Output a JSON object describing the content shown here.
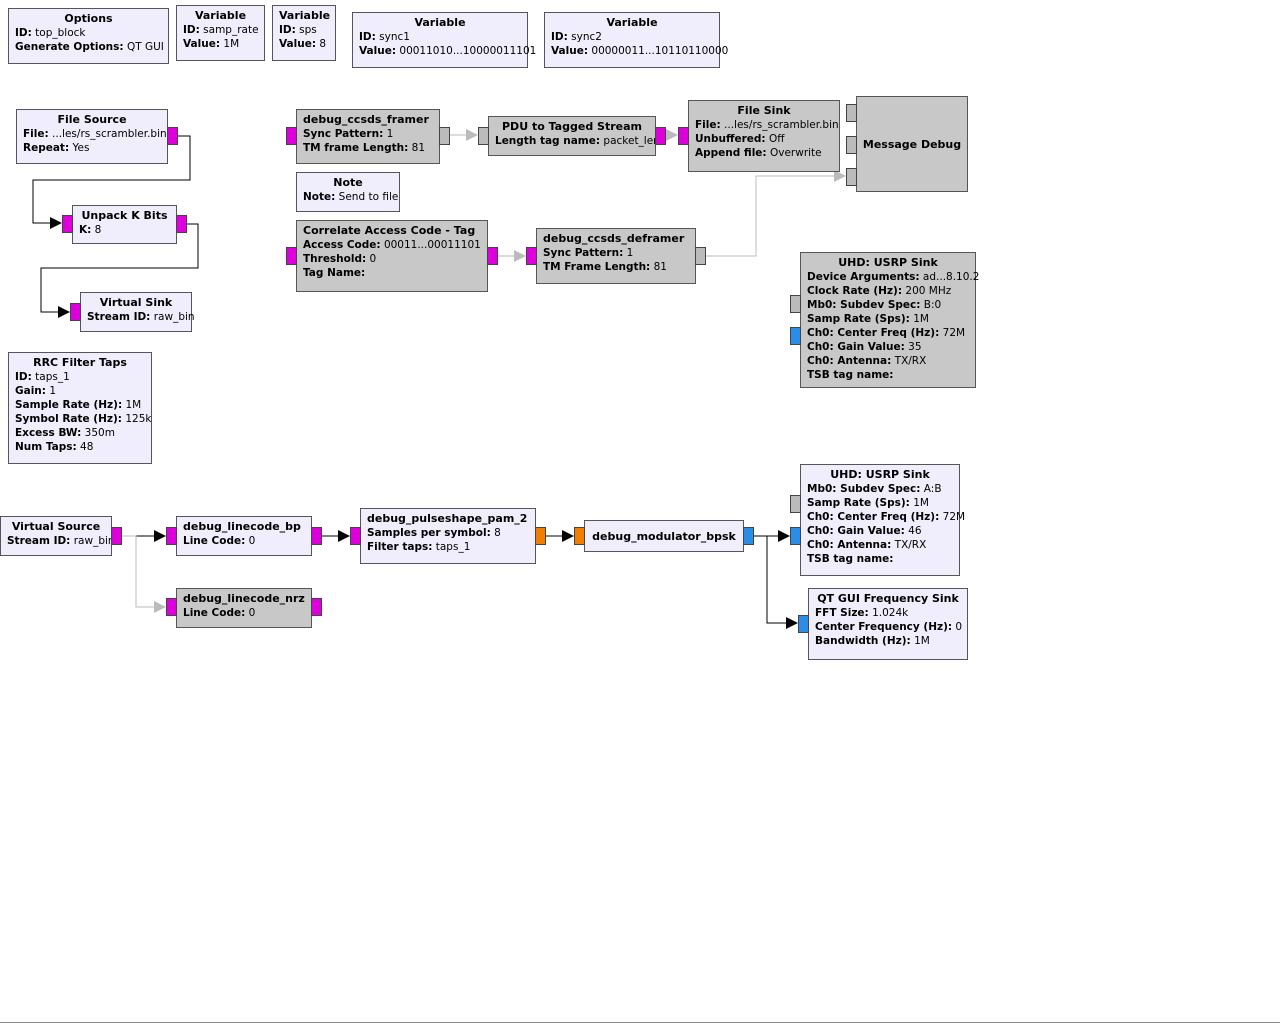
{
  "colors": {
    "enabled_block": "#f0eefc",
    "disabled_block": "#c8c8c8",
    "byte_port": "#dd00dd",
    "message_port": "#bbbbbb",
    "complex_port": "#2a8ee6",
    "float_port": "#f07f00"
  },
  "blocks": [
    {
      "id": "options",
      "title": "Options",
      "enabled": true,
      "params": [
        {
          "k": "ID:",
          "v": "top_block"
        },
        {
          "k": "Generate Options:",
          "v": "QT GUI"
        }
      ]
    },
    {
      "id": "variable-samp-rate",
      "title": "Variable",
      "enabled": true,
      "params": [
        {
          "k": "ID:",
          "v": "samp_rate"
        },
        {
          "k": "Value:",
          "v": "1M"
        }
      ]
    },
    {
      "id": "variable-sps",
      "title": "Variable",
      "enabled": true,
      "params": [
        {
          "k": "ID:",
          "v": "sps"
        },
        {
          "k": "Value:",
          "v": "8"
        }
      ]
    },
    {
      "id": "variable-sync1",
      "title": "Variable",
      "enabled": true,
      "params": [
        {
          "k": "ID:",
          "v": "sync1"
        },
        {
          "k": "Value:",
          "v": "00011010...10000011101"
        }
      ]
    },
    {
      "id": "variable-sync2",
      "title": "Variable",
      "enabled": true,
      "params": [
        {
          "k": "ID:",
          "v": "sync2"
        },
        {
          "k": "Value:",
          "v": "00000011...10110110000"
        }
      ]
    },
    {
      "id": "file-source",
      "title": "File Source",
      "enabled": true,
      "params": [
        {
          "k": "File:",
          "v": "...les/rs_scrambler.bin"
        },
        {
          "k": "Repeat:",
          "v": "Yes"
        }
      ]
    },
    {
      "id": "unpack-k-bits",
      "title": "Unpack K Bits",
      "enabled": true,
      "params": [
        {
          "k": "K:",
          "v": "8"
        }
      ]
    },
    {
      "id": "virtual-sink",
      "title": "Virtual Sink",
      "enabled": true,
      "params": [
        {
          "k": "Stream ID:",
          "v": "raw_bin"
        }
      ]
    },
    {
      "id": "rrc-filter-taps",
      "title": "RRC Filter Taps",
      "enabled": true,
      "params": [
        {
          "k": "ID:",
          "v": "taps_1"
        },
        {
          "k": "Gain:",
          "v": "1"
        },
        {
          "k": "Sample Rate (Hz):",
          "v": "1M"
        },
        {
          "k": "Symbol Rate (Hz):",
          "v": "125k"
        },
        {
          "k": "Excess BW:",
          "v": "350m"
        },
        {
          "k": "Num Taps:",
          "v": "48"
        }
      ]
    },
    {
      "id": "debug-ccsds-framer",
      "title": "debug_ccsds_framer",
      "enabled": false,
      "left": true,
      "params": [
        {
          "k": "Sync Pattern:",
          "v": "1"
        },
        {
          "k": "TM frame Length:",
          "v": "81"
        }
      ]
    },
    {
      "id": "pdu-to-tagged-stream",
      "title": "PDU to Tagged Stream",
      "enabled": false,
      "params": [
        {
          "k": "Length tag name:",
          "v": "packet_len"
        }
      ]
    },
    {
      "id": "file-sink",
      "title": "File Sink",
      "enabled": false,
      "params": [
        {
          "k": "File:",
          "v": "...les/rs_scrambler.bin"
        },
        {
          "k": "Unbuffered:",
          "v": "Off"
        },
        {
          "k": "Append file:",
          "v": "Overwrite"
        }
      ]
    },
    {
      "id": "message-debug",
      "title": "Message Debug",
      "enabled": false,
      "params": []
    },
    {
      "id": "note",
      "title": "Note",
      "enabled": true,
      "params": [
        {
          "k": "Note:",
          "v": "Send to file"
        }
      ]
    },
    {
      "id": "correlate-access-code-tag",
      "title": "Correlate Access Code - Tag",
      "enabled": false,
      "left": true,
      "params": [
        {
          "k": "Access Code:",
          "v": "00011...00011101"
        },
        {
          "k": "Threshold:",
          "v": "0"
        },
        {
          "k": "Tag Name:",
          "v": ""
        }
      ]
    },
    {
      "id": "debug-ccsds-deframer",
      "title": "debug_ccsds_deframer",
      "enabled": false,
      "left": true,
      "params": [
        {
          "k": "Sync Pattern:",
          "v": "1"
        },
        {
          "k": "TM Frame Length:",
          "v": "81"
        }
      ]
    },
    {
      "id": "uhd-usrp-sink-1",
      "title": "UHD: USRP Sink",
      "enabled": false,
      "params": [
        {
          "k": "Device Arguments:",
          "v": "ad...8.10.2"
        },
        {
          "k": "Clock Rate (Hz):",
          "v": "200 MHz"
        },
        {
          "k": "Mb0: Subdev Spec:",
          "v": "B:0"
        },
        {
          "k": "Samp Rate (Sps):",
          "v": "1M"
        },
        {
          "k": "Ch0: Center Freq (Hz):",
          "v": "72M"
        },
        {
          "k": "Ch0: Gain Value:",
          "v": "35"
        },
        {
          "k": "Ch0: Antenna:",
          "v": "TX/RX"
        },
        {
          "k": "TSB tag name:",
          "v": ""
        }
      ]
    },
    {
      "id": "virtual-source",
      "title": "Virtual Source",
      "enabled": true,
      "params": [
        {
          "k": "Stream ID:",
          "v": "raw_bin"
        }
      ]
    },
    {
      "id": "debug-linecode-bp",
      "title": "debug_linecode_bp",
      "enabled": true,
      "left": true,
      "params": [
        {
          "k": "Line Code:",
          "v": "0"
        }
      ]
    },
    {
      "id": "debug-linecode-nrz",
      "title": "debug_linecode_nrz",
      "enabled": false,
      "left": true,
      "params": [
        {
          "k": "Line Code:",
          "v": "0"
        }
      ]
    },
    {
      "id": "debug-pulseshape-pam-2",
      "title": "debug_pulseshape_pam_2",
      "enabled": true,
      "left": true,
      "params": [
        {
          "k": "Samples per symbol:",
          "v": "8"
        },
        {
          "k": "Filter taps:",
          "v": "taps_1"
        }
      ]
    },
    {
      "id": "debug-modulator-bpsk",
      "title": "debug_modulator_bpsk",
      "enabled": true,
      "left": true,
      "params": []
    },
    {
      "id": "uhd-usrp-sink-2",
      "title": "UHD: USRP Sink",
      "enabled": true,
      "params": [
        {
          "k": "Mb0: Subdev Spec:",
          "v": "A:B"
        },
        {
          "k": "Samp Rate (Sps):",
          "v": "1M"
        },
        {
          "k": "Ch0: Center Freq (Hz):",
          "v": "72M"
        },
        {
          "k": "Ch0: Gain Value:",
          "v": "46"
        },
        {
          "k": "Ch0: Antenna:",
          "v": "TX/RX"
        },
        {
          "k": "TSB tag name:",
          "v": ""
        }
      ]
    },
    {
      "id": "qt-gui-frequency-sink",
      "title": "QT GUI Frequency Sink",
      "enabled": true,
      "params": [
        {
          "k": "FFT Size:",
          "v": "1.024k"
        },
        {
          "k": "Center Frequency (Hz):",
          "v": "0"
        },
        {
          "k": "Bandwidth (Hz):",
          "v": "1M"
        }
      ]
    }
  ]
}
